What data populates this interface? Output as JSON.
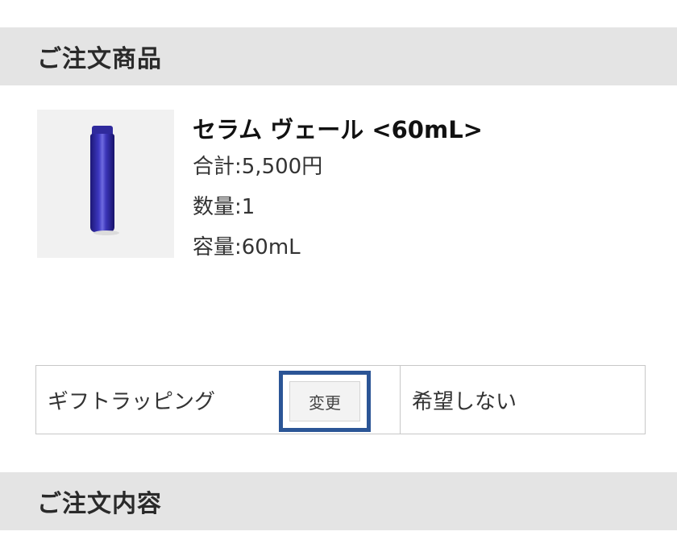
{
  "sections": {
    "order_items_title": "ご注文商品",
    "order_contents_title": "ご注文内容"
  },
  "product": {
    "name": "セラム ヴェール <60mL>",
    "total": "合計:5,500円",
    "quantity": "数量:1",
    "volume": "容量:60mL",
    "image_icon": "serum-bottle-icon",
    "bottle_color": "#2f2a9c"
  },
  "gift": {
    "label": "ギフトラッピング",
    "change_label": "変更",
    "value": "希望しない",
    "highlight_color": "#2b5596"
  }
}
